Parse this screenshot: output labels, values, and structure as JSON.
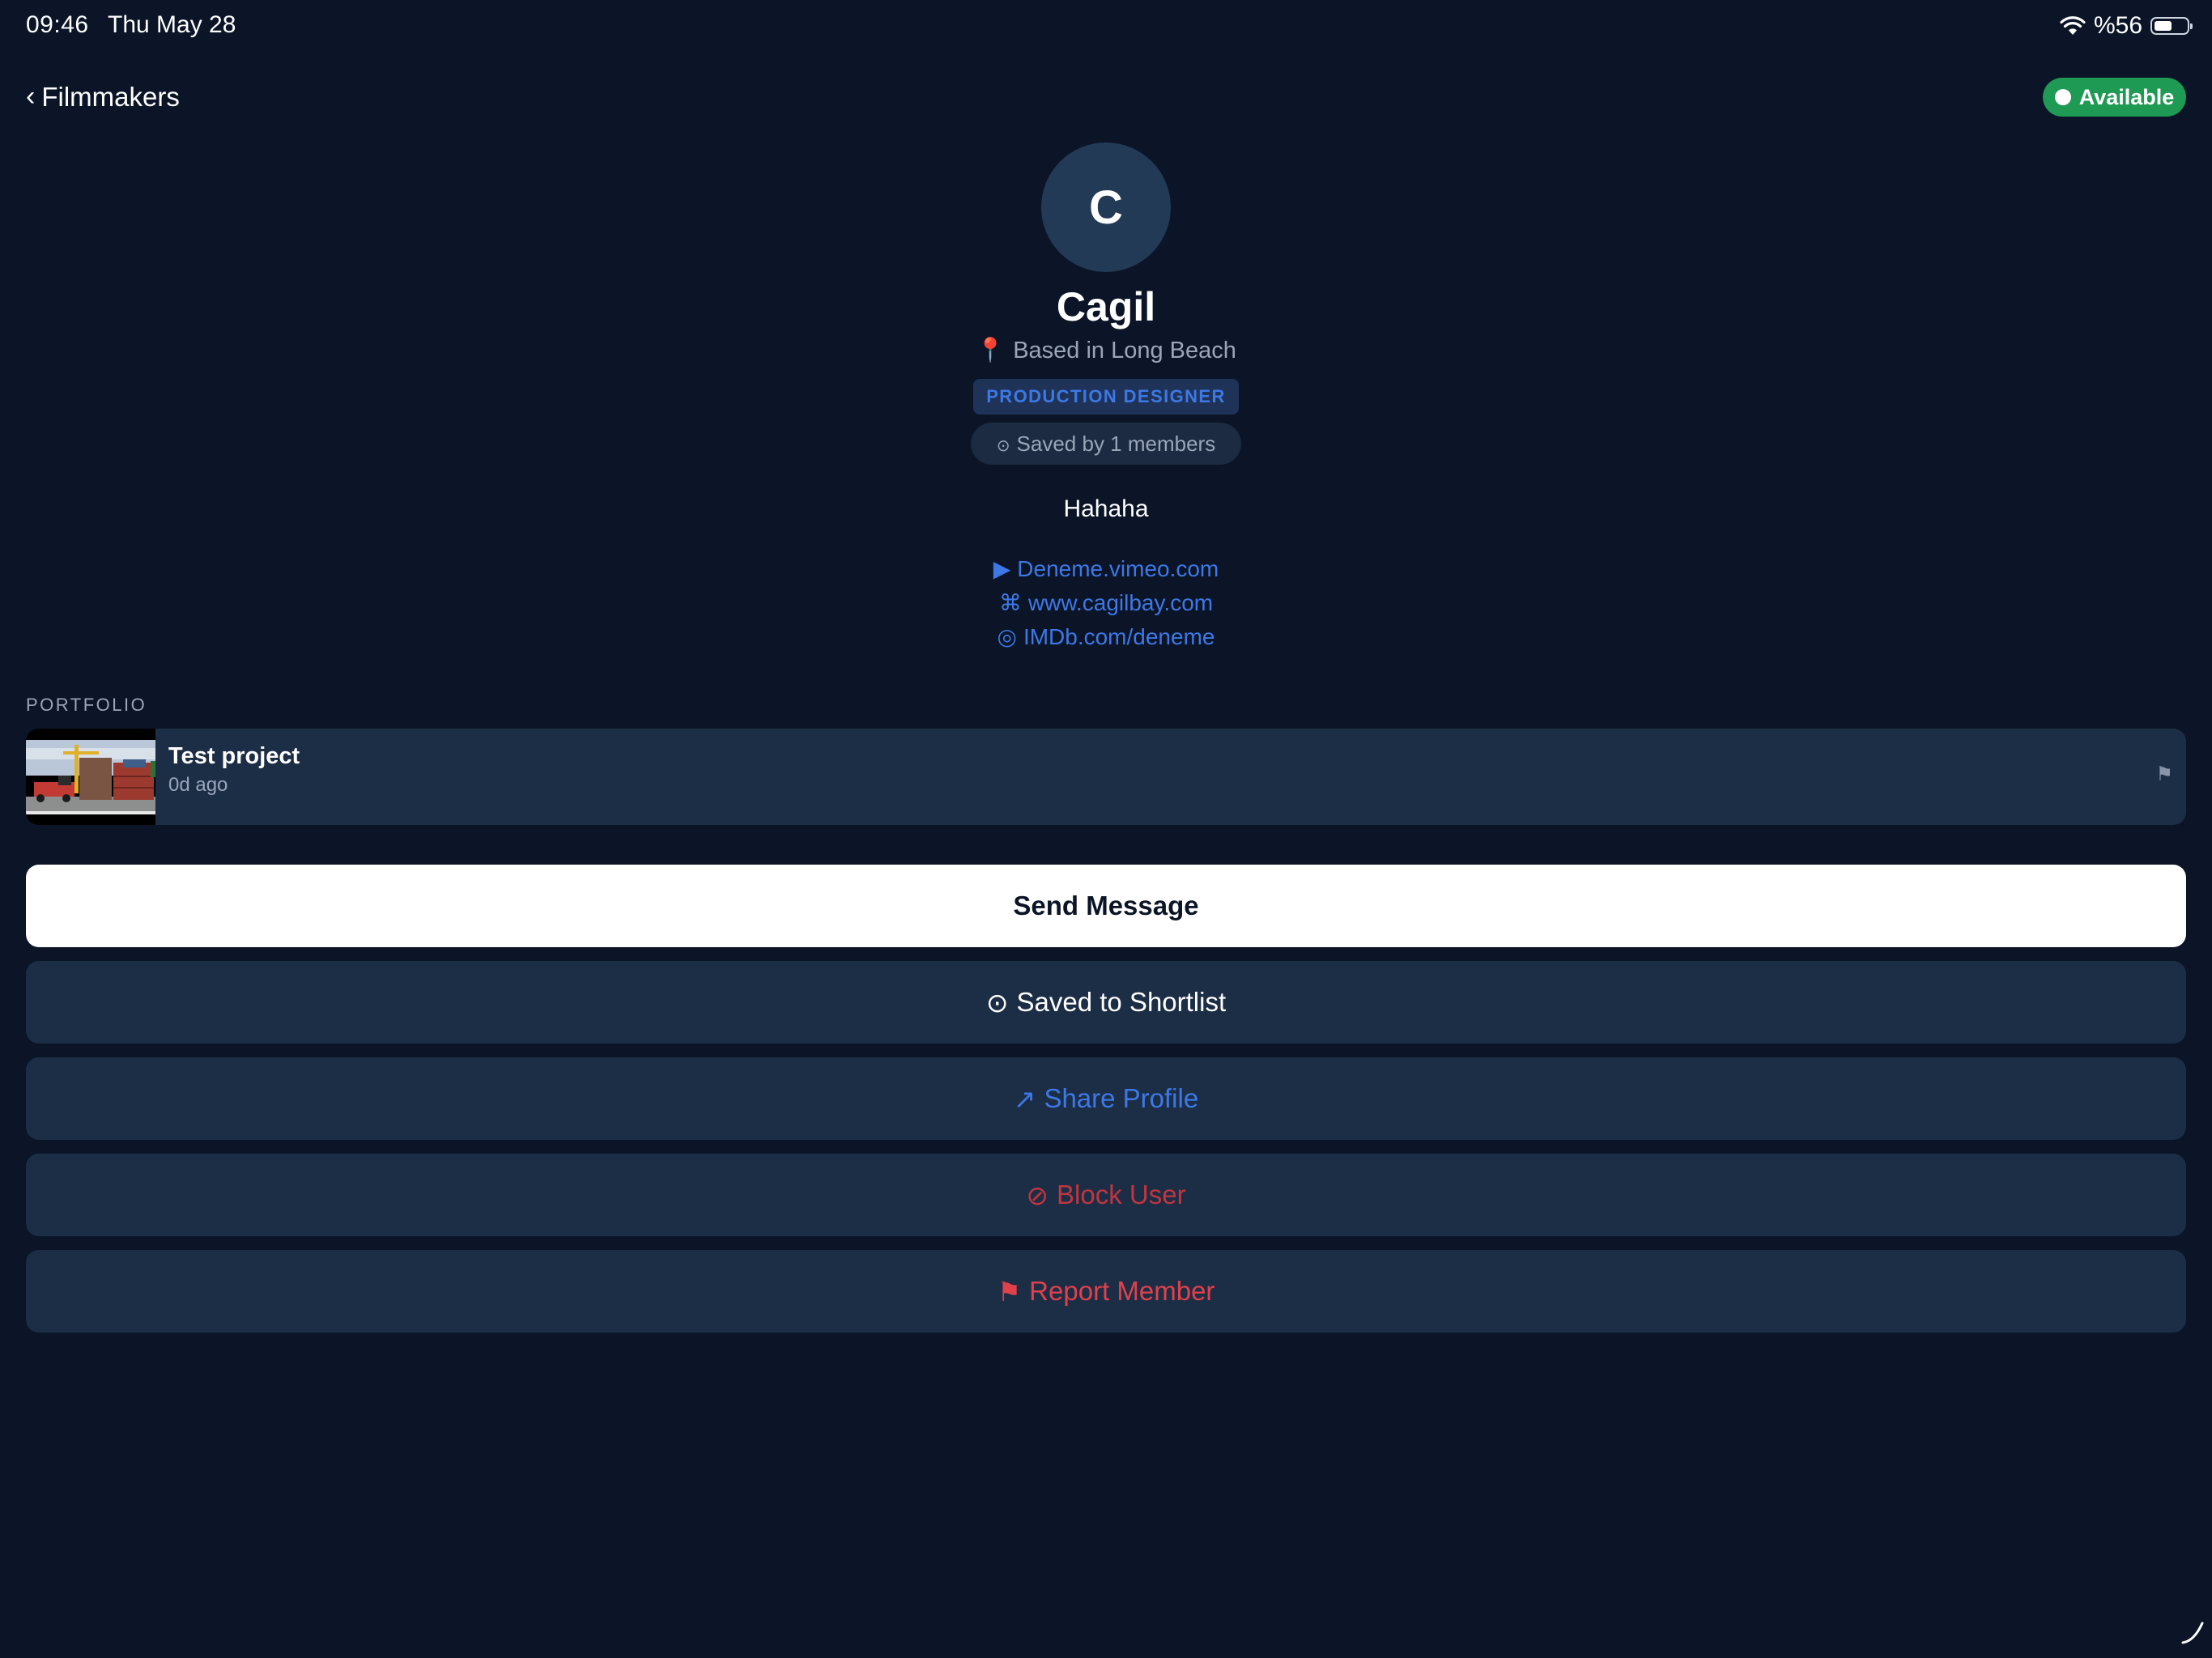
{
  "status_bar": {
    "time": "09:46",
    "date": "Thu May 28",
    "battery": "%56",
    "battery_level": 0.56
  },
  "nav": {
    "back_label": "Filmmakers",
    "availability": "Available"
  },
  "profile": {
    "avatar_initial": "C",
    "name": "Cagil",
    "location": "Based in Long Beach",
    "role": "PRODUCTION DESIGNER",
    "saved_by": "Saved by 1 members",
    "bio": "Hahaha",
    "links": [
      {
        "icon": "play-icon",
        "glyph": "▶",
        "text": "Deneme.vimeo.com"
      },
      {
        "icon": "command-icon",
        "glyph": "⌘",
        "text": "www.cagilbay.com"
      },
      {
        "icon": "circle-icon",
        "glyph": "◎",
        "text": "IMDb.com/deneme"
      }
    ]
  },
  "portfolio": {
    "label": "PORTFOLIO",
    "items": [
      {
        "title": "Test project",
        "subtitle": "0d ago"
      }
    ]
  },
  "actions": {
    "send_message": "Send Message",
    "shortlist": "Saved to Shortlist",
    "shortlist_icon": "⊙",
    "share": "Share Profile",
    "share_icon": "↗",
    "block": "Block User",
    "block_icon": "⊘",
    "report": "Report Member",
    "report_icon": "⚑"
  },
  "colors": {
    "background": "#0b1527",
    "card": "#1c2d46",
    "accent_blue": "#3d78e6",
    "available_green": "#1f9a55",
    "danger_red": "#e0414a"
  }
}
